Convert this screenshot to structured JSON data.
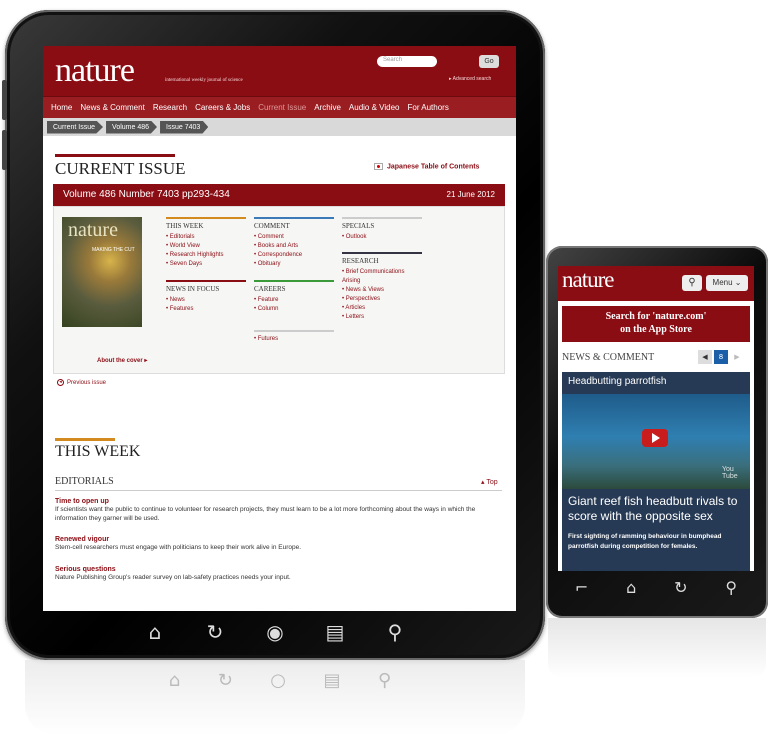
{
  "tablet": {
    "header": {
      "logo": "nature",
      "tagline": "international weekly journal of science",
      "search_placeholder": "Search",
      "go_label": "Go",
      "advanced_search": "▸ Advanced search"
    },
    "nav": [
      "Home",
      "News & Comment",
      "Research",
      "Careers & Jobs",
      "Current Issue",
      "Archive",
      "Audio & Video",
      "For Authors"
    ],
    "breadcrumb": [
      "Current Issue",
      "Volume 486",
      "Issue 7403"
    ],
    "section_title": "CURRENT ISSUE",
    "japanese_toc": "Japanese Table of Contents",
    "volume_line": "Volume 486 Number 7403 pp293-434",
    "date": "21 June 2012",
    "cover_logo": "nature",
    "cover_headline": "MAKING THE CUT",
    "about_cover": "About the cover ▸",
    "columns": {
      "this_week": {
        "title": "THIS WEEK",
        "links": [
          "• Editorials",
          "• World View",
          "• Research Highlights",
          "• Seven Days"
        ]
      },
      "news_in_focus": {
        "title": "NEWS IN FOCUS",
        "links": [
          "• News",
          "• Features"
        ]
      },
      "comment": {
        "title": "COMMENT",
        "links": [
          "• Comment",
          "• Books and Arts",
          "• Correspondence",
          "• Obituary"
        ]
      },
      "careers": {
        "title": "CAREERS",
        "links": [
          "• Feature",
          "• Column"
        ]
      },
      "futures": {
        "links": [
          "• Futures"
        ]
      },
      "specials": {
        "title": "SPECIALS",
        "links": [
          "• Outlook"
        ]
      },
      "research": {
        "title": "RESEARCH",
        "links": [
          "• Brief Communications Arising",
          "• News & Views",
          "• Perspectives",
          "• Articles",
          "• Letters"
        ]
      }
    },
    "previous_issue": "Previous issue",
    "this_week_title": "THIS WEEK",
    "editorials_title": "EDITORIALS",
    "top_link": "▴ Top",
    "articles": [
      {
        "title": "Time to open up",
        "body": "If scientists want the public to continue to volunteer for research projects, they must learn to be a lot more forthcoming about the ways in which the information they garner will be used."
      },
      {
        "title": "Renewed vigour",
        "body": "Stem-cell researchers must engage with politicians to keep their work alive in Europe."
      },
      {
        "title": "Serious questions",
        "body": "Nature Publishing Group's reader survey on lab-safety practices needs your input."
      }
    ],
    "bottom_icons": [
      "home-icon",
      "refresh-icon",
      "circle-button-icon",
      "list-icon",
      "search-icon"
    ]
  },
  "phone": {
    "logo": "nature",
    "menu_label": "Menu ⌄",
    "promo_line1": "Search for 'nature.com'",
    "promo_line2": "on the App Store",
    "section": "NEWS & COMMENT",
    "pager_current": "8",
    "card_title": "Headbutting parrotfish",
    "video_label": "You Tube",
    "headline": "Giant reef fish headbutt rivals to score with the opposite sex",
    "subline": "First sighting of ramming behaviour in bumphead parrotfish during competition for females.",
    "bottom_icons": [
      "back-icon",
      "home-icon",
      "refresh-icon",
      "search-icon"
    ]
  },
  "colors": {
    "brand": "#8b0d14",
    "navbar": "#9a1d22",
    "card": "#273a55"
  }
}
